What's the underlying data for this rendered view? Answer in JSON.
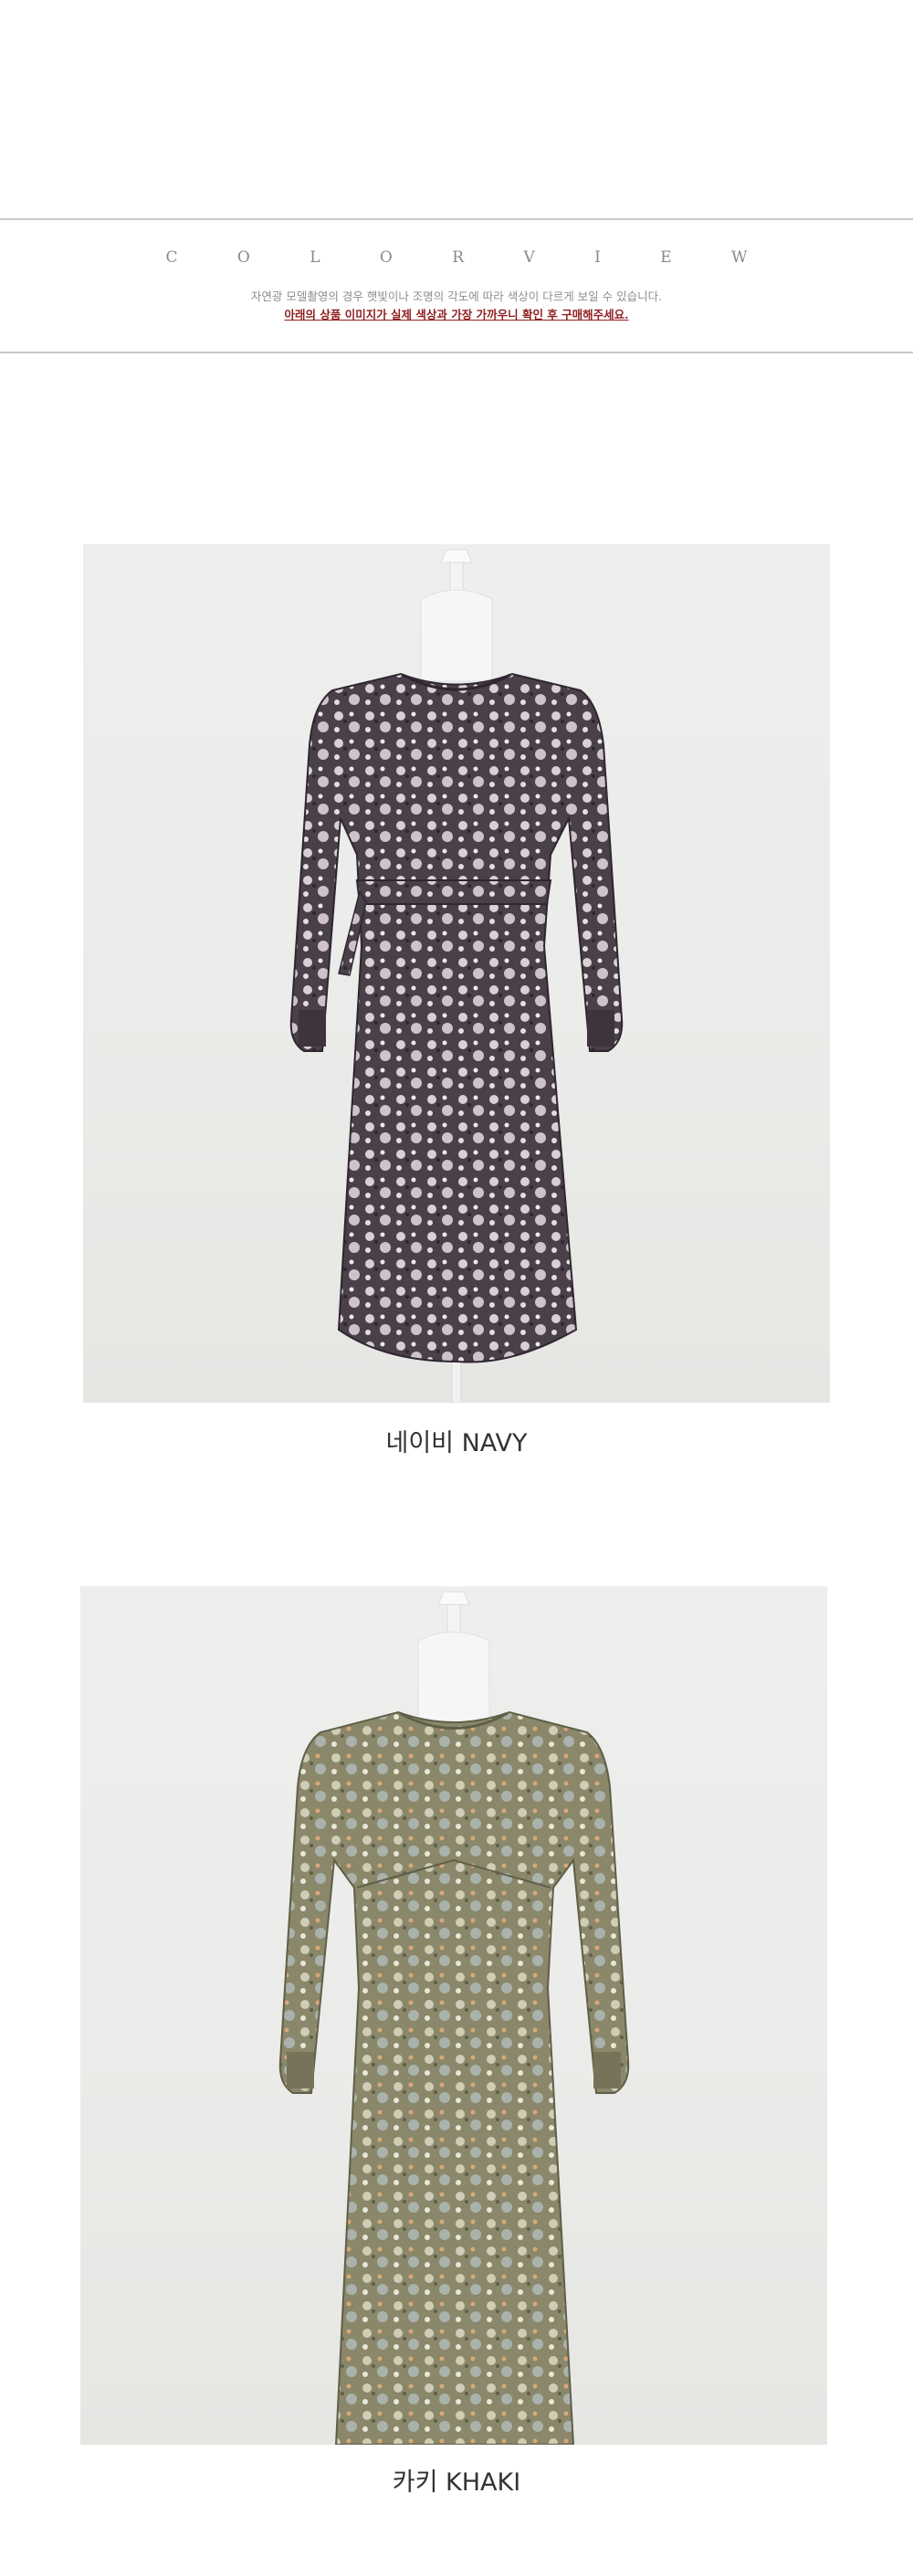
{
  "color_view": {
    "title": "C O L O R   V I E W",
    "note_line1": "자연광 모델촬영의 경우 햇빛이나 조명의 각도에 따라 색상이 다르게 보일 수 있습니다.",
    "note_line2": "아래의 상품 이미지가 실제 색상과 가장 가까우니 확인 후 구매해주세요."
  },
  "products": [
    {
      "caption": "네이비 NAVY",
      "dress_color": "#4a4048",
      "pattern_color": "#d9d0d6",
      "accent_color": "#2e2630"
    },
    {
      "caption": "카키 KHAKI",
      "dress_color": "#8a876a",
      "pattern_color": "#cfcdb6",
      "accent_color": "#5f5f48"
    }
  ],
  "colors": {
    "divider": "#c9c9c9",
    "title_gray": "#8a8a8a",
    "note_red": "#8f1f1f",
    "photo_background": "#ebebe9"
  }
}
